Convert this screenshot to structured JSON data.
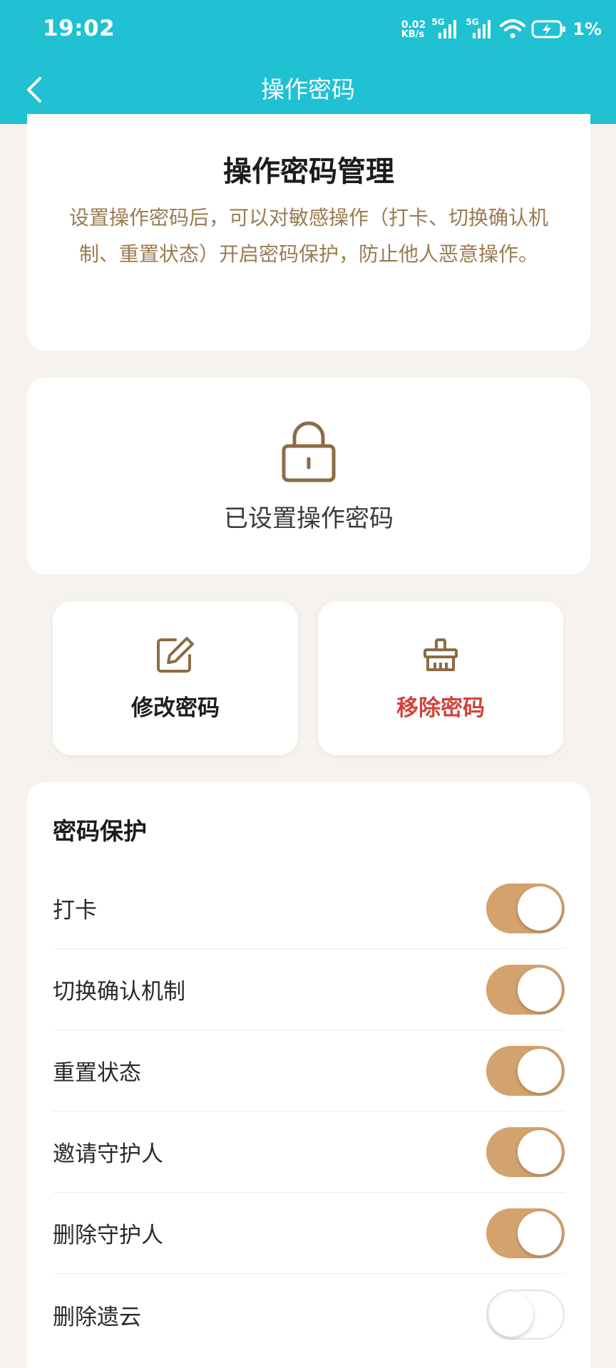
{
  "status_bar": {
    "time": "19:02",
    "net_speed_value": "0.02",
    "net_speed_unit": "KB/s",
    "signal_1_label": "5G",
    "signal_2_label": "5G",
    "battery_percent": "1%"
  },
  "header": {
    "title": "操作密码",
    "back_icon": "chevron-left-icon"
  },
  "intro": {
    "title": "操作密码管理",
    "description": "设置操作密码后，可以对敏感操作（打卡、切换确认机制、重置状态）开启密码保护，防止他人恶意操作。"
  },
  "status_card": {
    "icon": "lock-icon",
    "label": "已设置操作密码"
  },
  "actions": {
    "edit_label": "修改密码",
    "remove_label": "移除密码"
  },
  "protection": {
    "title": "密码保护",
    "items": [
      {
        "label": "打卡",
        "enabled": true
      },
      {
        "label": "切换确认机制",
        "enabled": true
      },
      {
        "label": "重置状态",
        "enabled": true
      },
      {
        "label": "邀请守护人",
        "enabled": true
      },
      {
        "label": "删除守护人",
        "enabled": true
      },
      {
        "label": "删除遗云",
        "enabled": false
      }
    ]
  },
  "colors": {
    "header_bg": "#1fc1d2",
    "accent": "#d3a26d",
    "danger": "#d0443d",
    "desc_text": "#9a7b52",
    "page_bg": "#f6f3ef"
  }
}
